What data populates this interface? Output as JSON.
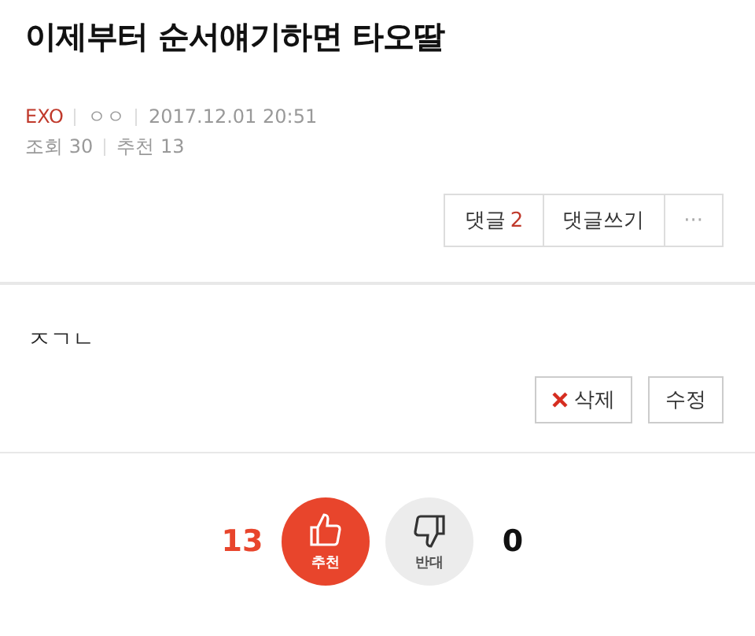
{
  "post": {
    "title": "이제부터 순서얘기하면 타오딸",
    "board": "EXO",
    "author": "ㅇㅇ",
    "datetime": "2017.12.01 20:51",
    "views_label": "조회",
    "views": "30",
    "recommends_label": "추천",
    "recommends": "13"
  },
  "actions": {
    "comments_label": "댓글",
    "comments_count": "2",
    "write_comment": "댓글쓰기",
    "more": "···"
  },
  "body": "ㅈㄱㄴ",
  "edit_buttons": [
    {
      "kind": "delete",
      "label": "삭제"
    },
    {
      "kind": "edit",
      "label": "수정"
    }
  ],
  "votes": [
    {
      "kind": "up",
      "label": "추천",
      "count": "13",
      "selected": true
    },
    {
      "kind": "down",
      "label": "반대",
      "count": "0",
      "selected": false
    }
  ]
}
